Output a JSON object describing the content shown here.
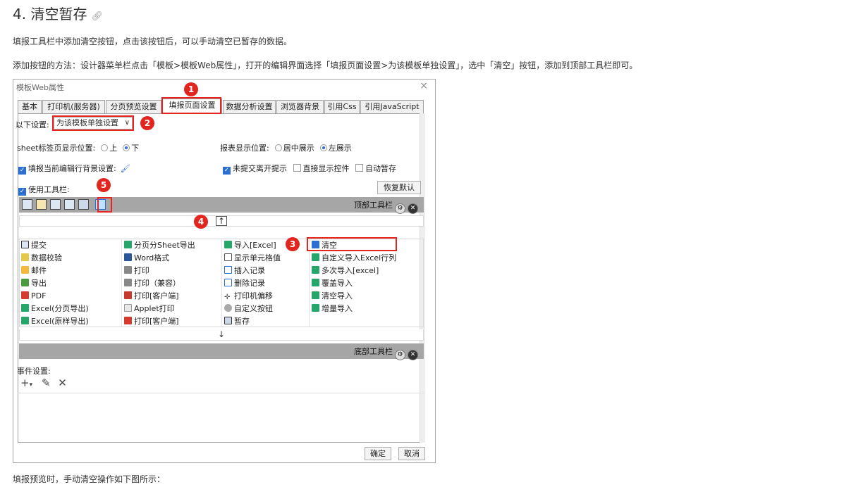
{
  "heading": {
    "title": "4. 清空暂存",
    "link_icon": "link-icon"
  },
  "paragraphs": {
    "p1": "填报工具栏中添加清空按钮，点击该按钮后，可以手动清空已暂存的数据。",
    "p2": "添加按钮的方法：设计器菜单栏点击「模板>模板Web属性」，打开的编辑界面选择「填报页面设置>为该模板单独设置」，选中「清空」按钮，添加到顶部工具栏即可。",
    "p3": "填报预览时，手动清空操作如下图所示："
  },
  "dialog": {
    "title": "模板Web属性",
    "close": "×",
    "tabs": [
      "基本",
      "打印机(服务器)",
      "分页预览设置",
      "填报页面设置",
      "数据分析设置",
      "浏览器背景",
      "引用Css",
      "引用JavaScript"
    ],
    "active_tab": "填报页面设置",
    "settings_label": "以下设置:",
    "settings_value": "为该模板单独设置",
    "sheet_pos_label": "sheet标签页显示位置:",
    "sheet_pos_top": "上",
    "sheet_pos_bottom": "下",
    "report_pos_label": "报表显示位置:",
    "report_pos_center": "居中展示",
    "report_pos_left": "左展示",
    "row_bg_label": "填报当前编辑行背景设置:",
    "unsubmitted_tip": "未提交离开提示",
    "show_controls": "直接显示控件",
    "auto_save": "自动暂存",
    "use_toolbar": "使用工具栏:",
    "restore_default": "恢复默认",
    "top_toolbar": "顶部工具栏",
    "bottom_toolbar": "底部工具栏",
    "up_arrow": "↑",
    "down_arrow": "↓",
    "event_settings": "事件设置:",
    "ok": "确定",
    "cancel": "取消",
    "buttons": {
      "col1": [
        "提交",
        "数据校验",
        "邮件",
        "导出",
        "PDF",
        "Excel(分页导出)",
        "Excel(原样导出)"
      ],
      "col2": [
        "分页分Sheet导出",
        "Word格式",
        "打印",
        "打印（兼容）",
        "打印[客户端]",
        "Applet打印",
        "打印[客户端]"
      ],
      "col3": [
        "导入[Excel]",
        "显示单元格值",
        "插入记录",
        "删除记录",
        "打印机偏移",
        "自定义按钮",
        "暂存"
      ],
      "col4": [
        "清空",
        "自定义导入Excel行列",
        "多次导入[excel]",
        "覆盖导入",
        "清空导入",
        "增量导入"
      ]
    },
    "markers": [
      "1",
      "2",
      "3",
      "4",
      "5"
    ]
  }
}
